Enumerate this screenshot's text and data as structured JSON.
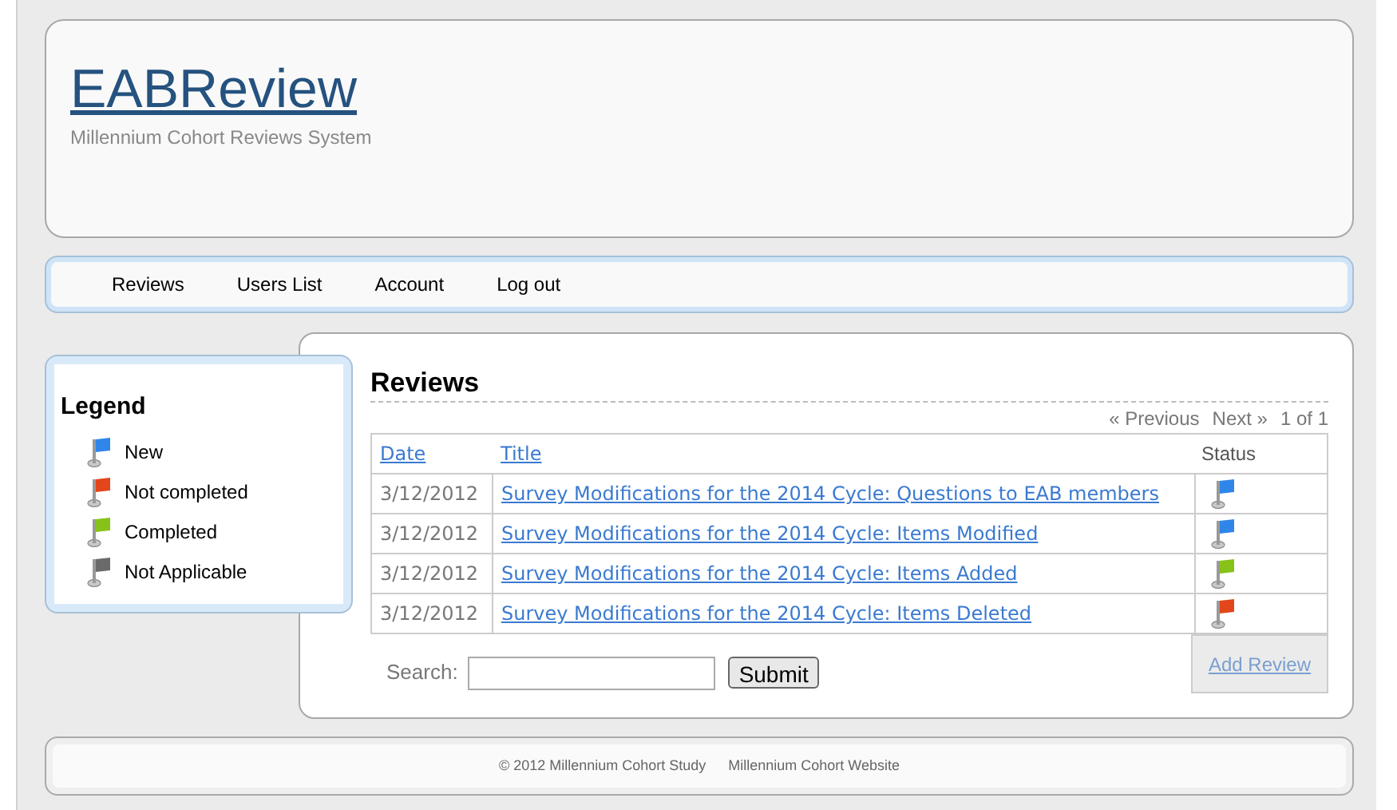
{
  "site": {
    "title": "EABReview",
    "subtitle": "Millennium Cohort Reviews System"
  },
  "nav": [
    "Reviews",
    "Users List",
    "Account",
    "Log out"
  ],
  "legend": {
    "title": "Legend",
    "items": [
      {
        "label": "New",
        "color": "#2f86e8"
      },
      {
        "label": "Not completed",
        "color": "#e2461a"
      },
      {
        "label": "Completed",
        "color": "#86c21a"
      },
      {
        "label": "Not Applicable",
        "color": "#6a6a6a"
      }
    ]
  },
  "reviews": {
    "title": "Reviews",
    "pager": {
      "previous": "« Previous",
      "next": "Next »",
      "page": "1 of 1"
    },
    "columns": [
      "Date",
      "Title",
      "Status"
    ],
    "rows": [
      {
        "date": "3/12/2012",
        "title": "Survey Modifications for the 2014 Cycle: Questions to EAB members",
        "color": "#2f86e8"
      },
      {
        "date": "3/12/2012",
        "title": "Survey Modifications for the 2014 Cycle: Items Modified",
        "color": "#2f86e8"
      },
      {
        "date": "3/12/2012",
        "title": "Survey Modifications for the 2014 Cycle: Items Added",
        "color": "#86c21a"
      },
      {
        "date": "3/12/2012",
        "title": "Survey Modifications for the 2014 Cycle: Items Deleted",
        "color": "#e2461a"
      }
    ],
    "search": {
      "label": "Search:",
      "button": "Submit"
    },
    "add": "Add Review"
  },
  "footer": {
    "copyright": "© 2012 Millennium Cohort Study",
    "link": "Millennium Cohort Website"
  }
}
